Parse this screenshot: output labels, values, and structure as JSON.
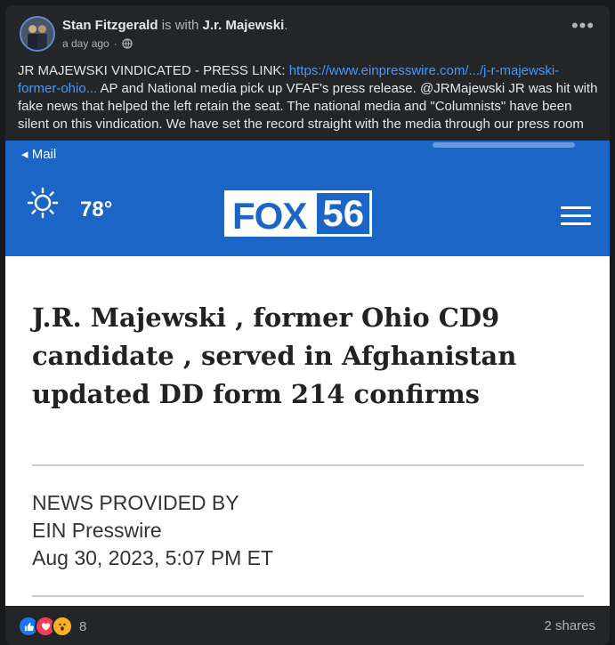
{
  "post": {
    "author": "Stan Fitzgerald",
    "with_text": "is with",
    "tagged": "J.r. Majewski",
    "timestamp": "a day ago",
    "separator": "·",
    "more_icon": "•••",
    "text_before_link": "JR MAJEWSKI VINDICATED - PRESS LINK: ",
    "link_text": "https://www.einpresswire.com/.../j-r-majewski-former-ohio...",
    "text_after_link": " AP and National media pick up VFAF's press release.  @JRMajewski JR was hit with fake news that helped the left retain the seat. The national media and \"Columnists\" have been silent on this vindication. We have set the record straight with the media through our press room"
  },
  "screenshot": {
    "mail_back": "◂ Mail",
    "temperature": "78°",
    "logo_text": "FOX",
    "logo_number": "56",
    "headline": "J.R. Majewski , former Ohio CD9 candidate , served in Afghanistan updated DD form 214 confirms",
    "news_label": "NEWS PROVIDED BY",
    "provider": "EIN Presswire",
    "date": "Aug 30, 2023, 5:07 PM ET"
  },
  "footer": {
    "reaction_count": "8",
    "shares": "2 shares",
    "reaction_icons": [
      "like-icon",
      "love-icon",
      "wow-icon"
    ]
  },
  "colors": {
    "background": "#18191a",
    "card": "#242526",
    "link": "#4599ff",
    "fox_blue": "#1b65c6"
  }
}
